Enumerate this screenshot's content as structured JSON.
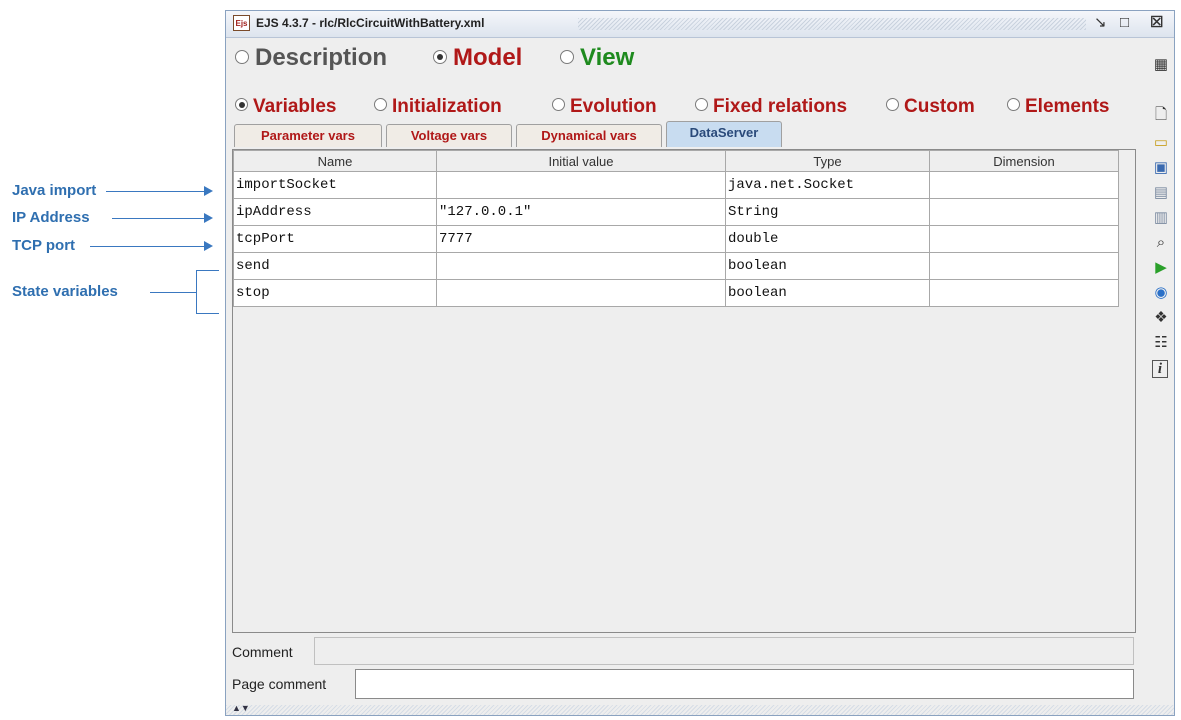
{
  "annotations": [
    {
      "label": "Java import"
    },
    {
      "label": "IP Address"
    },
    {
      "label": "TCP port"
    },
    {
      "label": "State variables"
    }
  ],
  "window": {
    "app_icon_text": "Ejs",
    "title": "EJS 4.3.7 - rlc/RlcCircuitWithBattery.xml",
    "restore_icon": "restore-icon",
    "maximize_icon": "maximize-icon",
    "close_icon": "close-icon"
  },
  "modes": [
    {
      "label": "Description",
      "selected": false,
      "color": "#555555"
    },
    {
      "label": "Model",
      "selected": true,
      "color": "#b01818"
    },
    {
      "label": "View",
      "selected": false,
      "color": "#1e8a1e"
    }
  ],
  "model_tabs": [
    {
      "label": "Variables",
      "selected": true
    },
    {
      "label": "Initialization",
      "selected": false
    },
    {
      "label": "Evolution",
      "selected": false
    },
    {
      "label": "Fixed relations",
      "selected": false
    },
    {
      "label": "Custom",
      "selected": false
    },
    {
      "label": "Elements",
      "selected": false
    }
  ],
  "var_tabs": [
    {
      "label": "Parameter vars",
      "active": false
    },
    {
      "label": "Voltage vars",
      "active": false
    },
    {
      "label": "Dynamical vars",
      "active": false
    },
    {
      "label": "DataServer",
      "active": true
    }
  ],
  "table": {
    "columns": [
      "Name",
      "Initial value",
      "Type",
      "Dimension"
    ],
    "rows": [
      {
        "name": "importSocket",
        "value": "",
        "type": "java.net.Socket",
        "dimension": ""
      },
      {
        "name": "ipAddress",
        "value": "\"127.0.0.1\"",
        "type": "String",
        "dimension": ""
      },
      {
        "name": "tcpPort",
        "value": "7777",
        "type": "double",
        "dimension": ""
      },
      {
        "name": "send",
        "value": "",
        "type": "boolean",
        "dimension": ""
      },
      {
        "name": "stop",
        "value": "",
        "type": "boolean",
        "dimension": ""
      }
    ]
  },
  "comment_label": "Comment",
  "page_comment_label": "Page comment",
  "toolbar_icons": [
    "grid-icon",
    "new-file-icon",
    "open-folder-icon",
    "open-remote-icon",
    "save-icon",
    "save-as-icon",
    "search-icon",
    "run-icon",
    "web-icon",
    "library-icon",
    "options-icon",
    "info-icon"
  ]
}
